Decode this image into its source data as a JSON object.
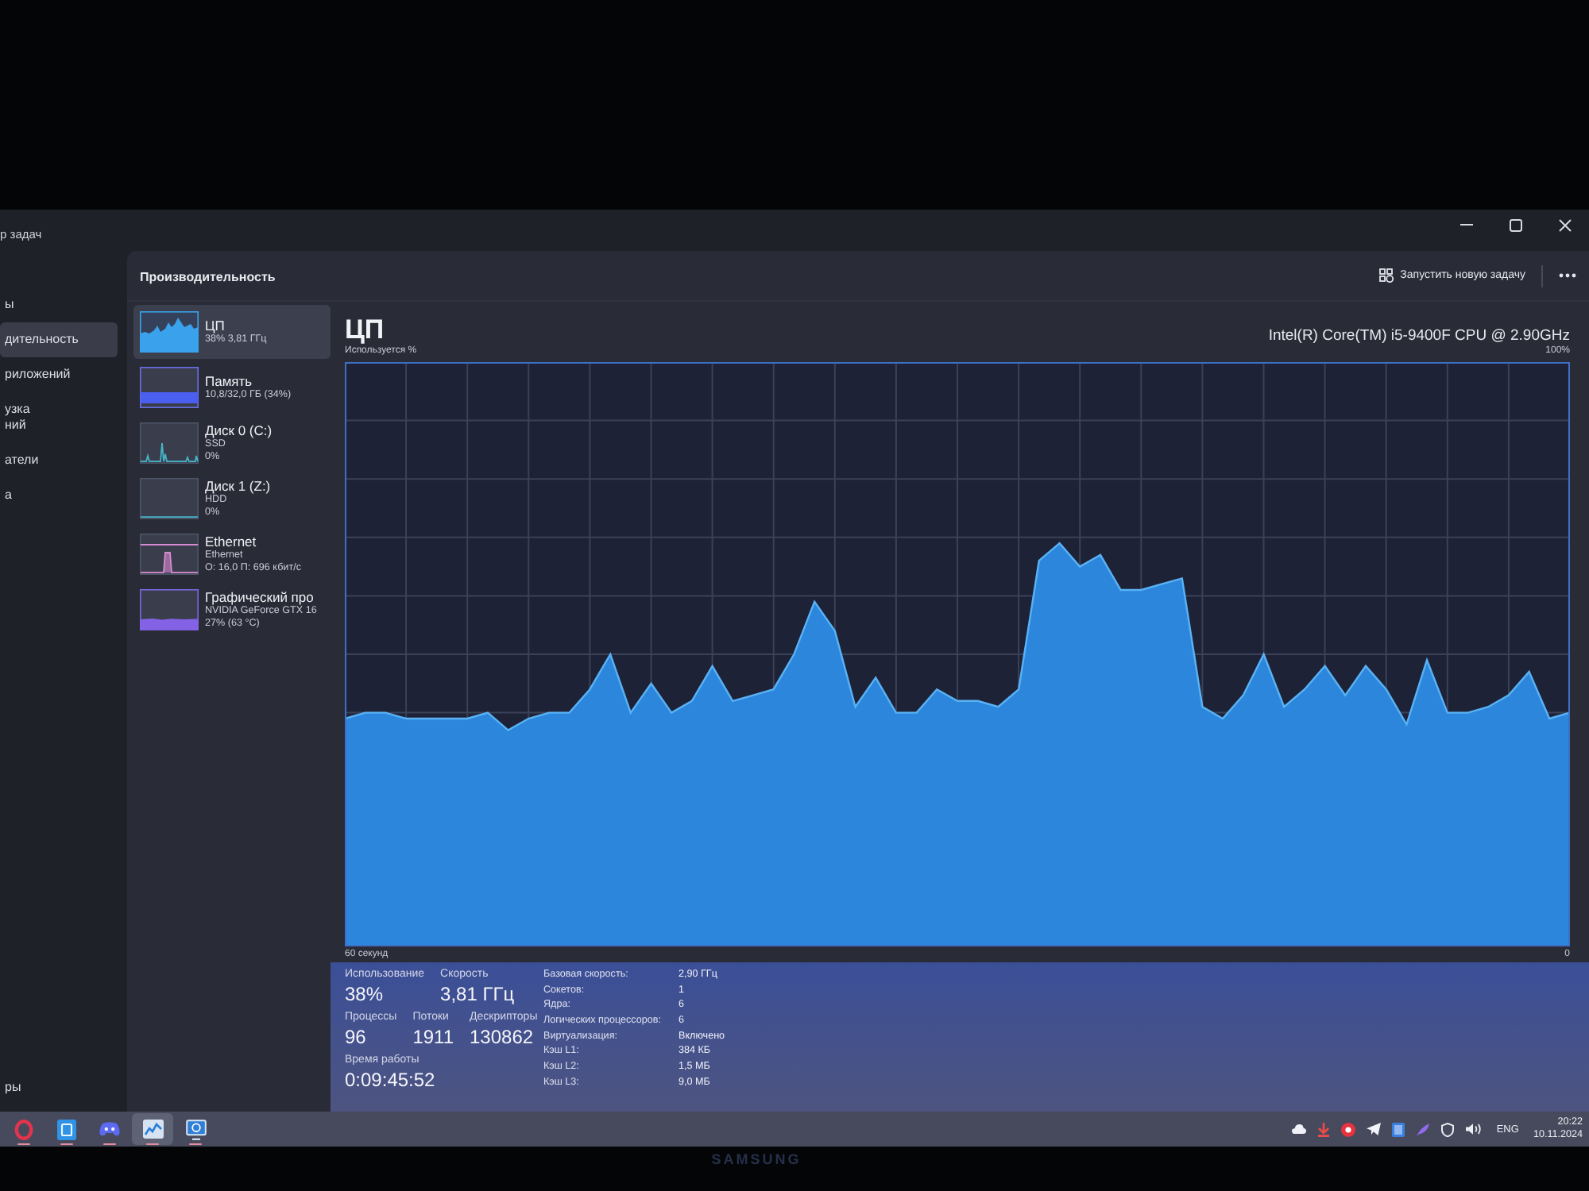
{
  "window": {
    "title": "р задач"
  },
  "nav": {
    "items": [
      {
        "label": "ы",
        "selected": false
      },
      {
        "label": "дительность",
        "selected": true
      },
      {
        "label": "риложений",
        "selected": false
      },
      {
        "label": "узка\nний",
        "selected": false
      },
      {
        "label": "атели",
        "selected": false
      },
      {
        "label": "а",
        "selected": false
      }
    ],
    "bottom_items": [
      {
        "label": "ры",
        "selected": false
      }
    ]
  },
  "page": {
    "title": "Производительность",
    "actions": [
      {
        "label": "Запустить новую задачу"
      }
    ]
  },
  "resources": {
    "items": [
      {
        "kind": "cpu",
        "name": "ЦП",
        "details": [
          "38% 3,81 ГГц"
        ],
        "selected": true
      },
      {
        "kind": "memory",
        "name": "Память",
        "details": [
          "10,8/32,0 ГБ (34%)"
        ],
        "selected": false
      },
      {
        "kind": "disk",
        "name": "Диск 0 (C:)",
        "details": [
          "SSD",
          "0%"
        ],
        "selected": false
      },
      {
        "kind": "hdd",
        "name": "Диск 1 (Z:)",
        "details": [
          "HDD",
          "0%"
        ],
        "selected": false
      },
      {
        "kind": "network",
        "name": "Ethernet",
        "details": [
          "Ethernet",
          "О: 16,0 П: 696 кбит/с"
        ],
        "selected": false
      },
      {
        "kind": "gpu",
        "name": "Графический про",
        "details": [
          "NVIDIA GeForce GTX 16",
          "27% (63 °C)"
        ],
        "selected": false
      }
    ]
  },
  "detail": {
    "title": "ЦП",
    "processor": "Intel(R) Core(TM) i5-9400F CPU @ 2.90GHz",
    "graph": {
      "caption": "Используется %",
      "max_label": "100%",
      "time_span": "60 секунд",
      "end_label": "0"
    },
    "stat_rows": [
      [
        {
          "label": "Использование",
          "value": "38%"
        },
        {
          "label": "Скорость",
          "value": "3,81 ГГц"
        }
      ],
      [
        {
          "label": "Процессы",
          "value": "96"
        },
        {
          "label": "Потоки",
          "value": "1911"
        },
        {
          "label": "Дескрипторы",
          "value": "130862"
        }
      ],
      [
        {
          "label": "Время работы",
          "value": "0:09:45:52"
        }
      ]
    ],
    "specs": [
      {
        "label": "Базовая скорость:",
        "value": "2,90 ГГц"
      },
      {
        "label": "Сокетов:",
        "value": "1"
      },
      {
        "label": "Ядра:",
        "value": "6"
      },
      {
        "label": "Логических процессоров:",
        "value": "6"
      },
      {
        "label": "Виртуализация:",
        "value": "Включено"
      },
      {
        "label": "Кэш L1:",
        "value": "384 КБ"
      },
      {
        "label": "Кэш L2:",
        "value": "1,5 МБ"
      },
      {
        "label": "Кэш L3:",
        "value": "9,0 МБ"
      }
    ]
  },
  "taskbar": {
    "apps": [
      {
        "kind": "ring",
        "running": true,
        "selected": false
      },
      {
        "kind": "tile",
        "running": true,
        "selected": false
      },
      {
        "kind": "controller",
        "running": true,
        "selected": false
      },
      {
        "kind": "chart",
        "running": true,
        "selected": true
      },
      {
        "kind": "monitor",
        "running": true,
        "selected": false
      }
    ],
    "language": "ENG",
    "time": "20:22",
    "date": "10.11.2024"
  },
  "monitor": {
    "brand": "SAMSUNG"
  }
}
